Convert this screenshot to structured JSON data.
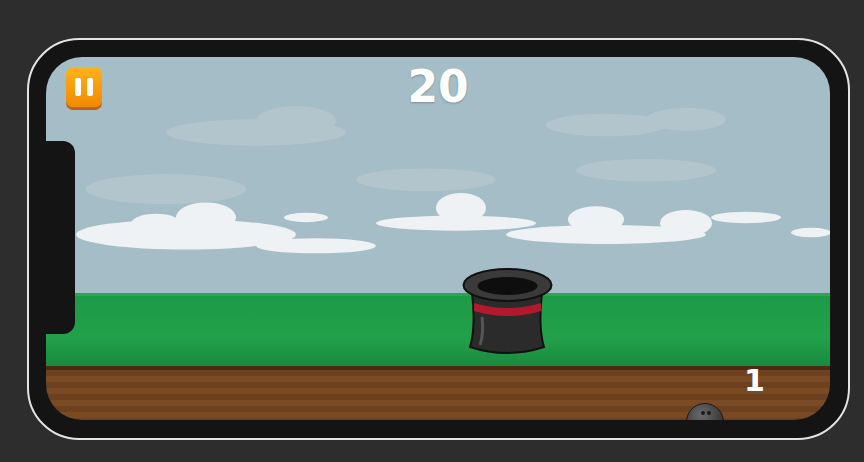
{
  "hud": {
    "score": "20",
    "ball_count": "1"
  }
}
